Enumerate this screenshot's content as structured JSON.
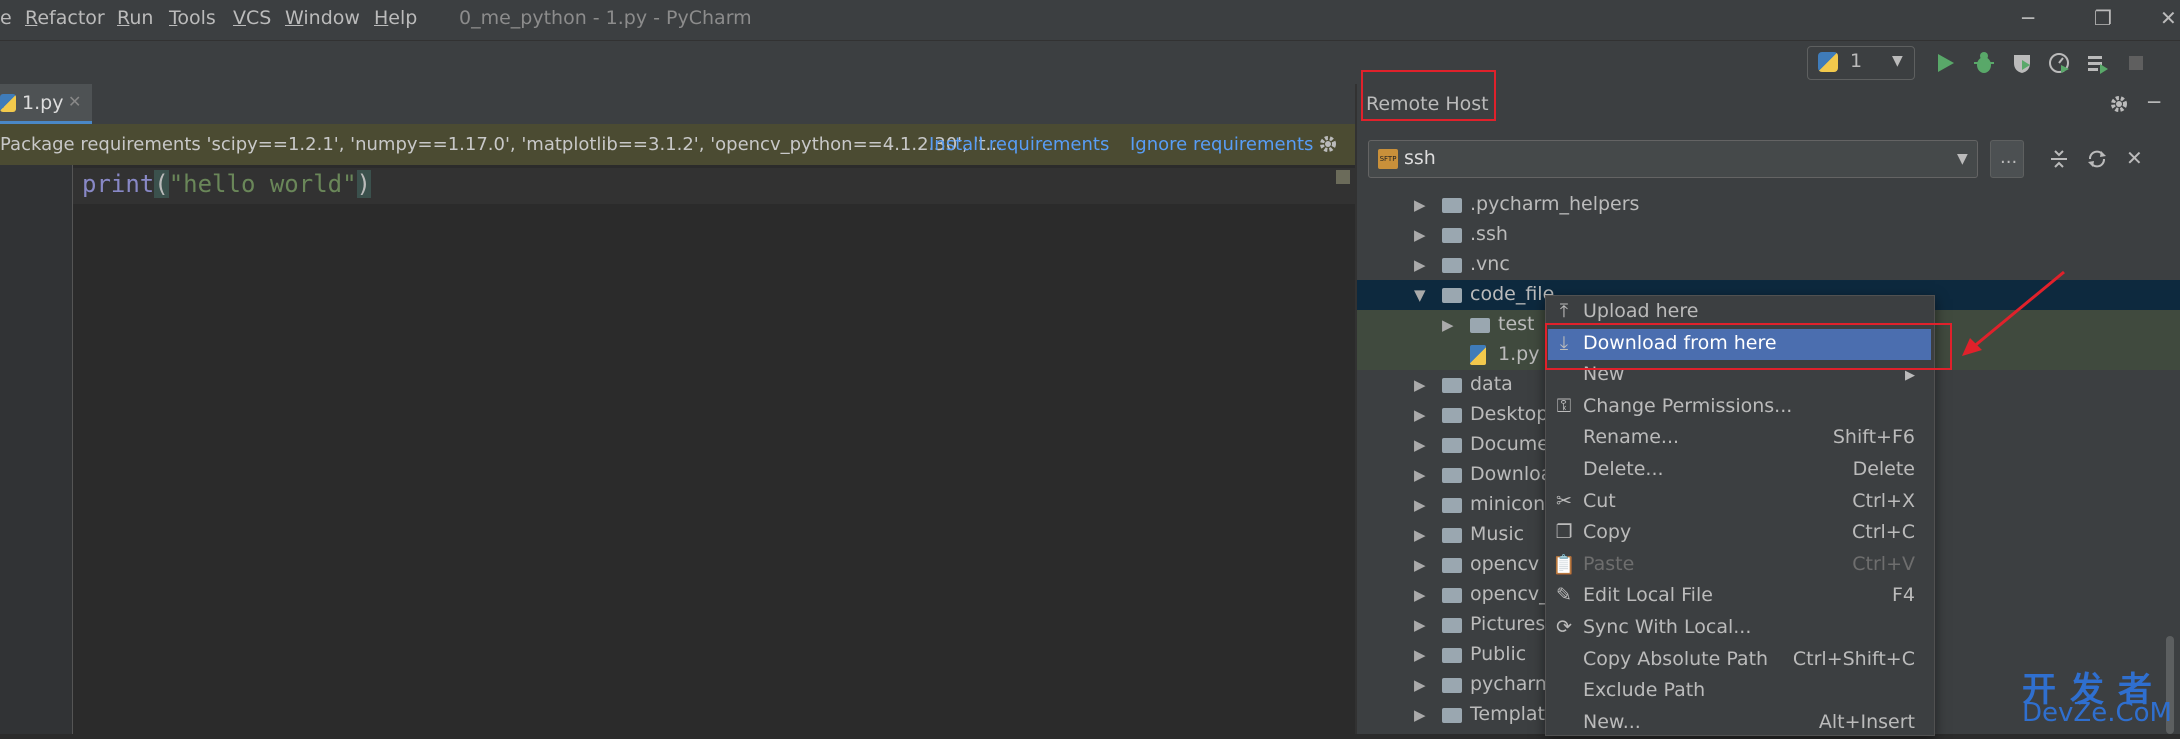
{
  "menubar": {
    "items": [
      {
        "label": "e",
        "u": ""
      },
      {
        "label": "efactor",
        "u": "R"
      },
      {
        "label": "un",
        "u": "R"
      },
      {
        "label": "ools",
        "u": "T"
      },
      {
        "label": "CS",
        "u": "V"
      },
      {
        "label": "indow",
        "u": "W"
      },
      {
        "label": "elp",
        "u": "H"
      }
    ],
    "window_title": "0_me_python - 1.py - PyCharm"
  },
  "toolbar": {
    "run_config": "1"
  },
  "editor": {
    "tab_label": "1.py",
    "banner_text": "Package requirements 'scipy==1.2.1', 'numpy==1.17.0', 'matplotlib==3.1.2', 'opencv_python==4.1.2.30', 't...",
    "install_label": "Install requirements",
    "ignore_label": "Ignore requirements",
    "code": {
      "func": "print",
      "open": "(",
      "string": "\"hello world\"",
      "close": ")"
    }
  },
  "remote_host": {
    "title": "Remote Host",
    "server": "ssh",
    "more_label": "...",
    "tree": [
      {
        "label": ".pycharm_helpers",
        "expanded": false,
        "depth": 0
      },
      {
        "label": ".ssh",
        "expanded": false,
        "depth": 0
      },
      {
        "label": ".vnc",
        "expanded": false,
        "depth": 0
      },
      {
        "label": "code_file",
        "expanded": true,
        "depth": 0
      },
      {
        "label": "test",
        "expanded": false,
        "depth": 1
      },
      {
        "label": "1.py",
        "expanded": false,
        "depth": 1,
        "file": true
      },
      {
        "label": "data",
        "expanded": false,
        "depth": 0
      },
      {
        "label": "Desktop",
        "expanded": false,
        "depth": 0
      },
      {
        "label": "Documer",
        "expanded": false,
        "depth": 0
      },
      {
        "label": "Downloa",
        "expanded": false,
        "depth": 0
      },
      {
        "label": "minicon",
        "expanded": false,
        "depth": 0
      },
      {
        "label": "Music",
        "expanded": false,
        "depth": 0
      },
      {
        "label": "opencv",
        "expanded": false,
        "depth": 0
      },
      {
        "label": "opencv_c",
        "expanded": false,
        "depth": 0
      },
      {
        "label": "Pictures",
        "expanded": false,
        "depth": 0
      },
      {
        "label": "Public",
        "expanded": false,
        "depth": 0
      },
      {
        "label": "pycharm",
        "expanded": false,
        "depth": 0
      },
      {
        "label": "Template",
        "expanded": false,
        "depth": 0
      }
    ]
  },
  "context_menu": {
    "items": [
      {
        "label": "Upload here",
        "shortcut": "",
        "icon": "upload-icon"
      },
      {
        "label": "Download from here",
        "shortcut": "",
        "icon": "download-icon",
        "selected": true
      },
      {
        "label": "New",
        "shortcut": "",
        "icon": "",
        "submenu": true
      },
      {
        "label": "Change Permissions...",
        "shortcut": "",
        "icon": "key-icon"
      },
      {
        "label": "Rename...",
        "shortcut": "Shift+F6",
        "icon": ""
      },
      {
        "label": "Delete...",
        "shortcut": "Delete",
        "icon": ""
      },
      {
        "label": "Cut",
        "shortcut": "Ctrl+X",
        "icon": "scissors-icon"
      },
      {
        "label": "Copy",
        "shortcut": "Ctrl+C",
        "icon": "copy-icon"
      },
      {
        "label": "Paste",
        "shortcut": "Ctrl+V",
        "icon": "paste-icon",
        "disabled": true
      },
      {
        "label": "Edit Local File",
        "shortcut": "F4",
        "icon": "edit-icon"
      },
      {
        "label": "Sync With Local...",
        "shortcut": "",
        "icon": "sync-icon"
      },
      {
        "label": "Copy Absolute Path",
        "shortcut": "Ctrl+Shift+C",
        "icon": ""
      },
      {
        "label": "Exclude Path",
        "shortcut": "",
        "icon": ""
      },
      {
        "label": "New...",
        "shortcut": "Alt+Insert",
        "icon": ""
      }
    ]
  },
  "watermark": {
    "line1": "开发者",
    "line2": "DevZe.CoM"
  },
  "colors": {
    "accent": "#4b6eaf",
    "annotation": "#e0212b",
    "run": "#59a869",
    "link": "#589df6"
  }
}
